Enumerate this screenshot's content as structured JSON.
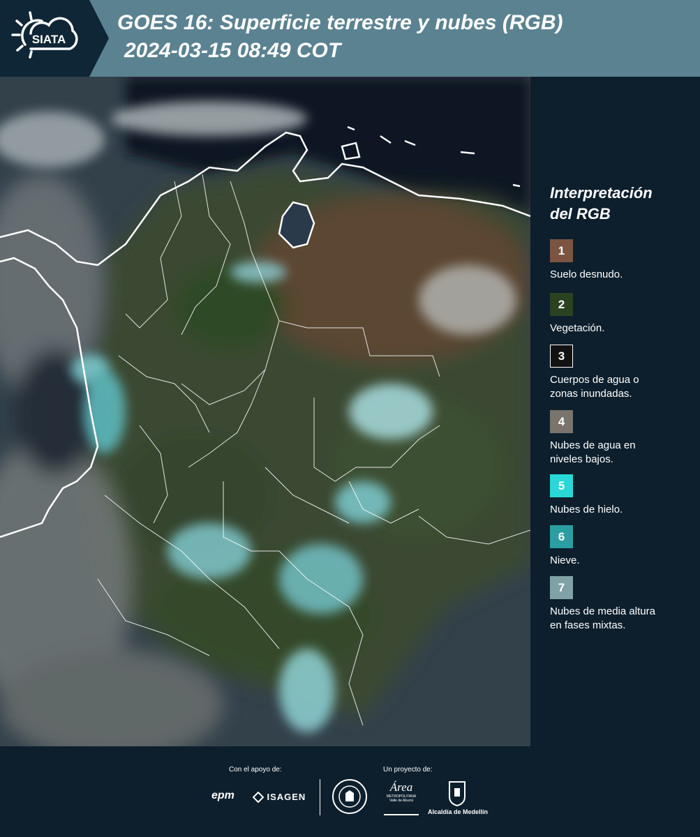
{
  "header": {
    "logo_text": "SIATA",
    "title_line1": "GOES 16: Superficie terrestre y nubes (RGB)",
    "title_line2": "2024-03-15 08:49 COT"
  },
  "legend": {
    "title_line1": "Interpretación",
    "title_line2": "del RGB",
    "items": [
      {
        "number": "1",
        "color": "#7b5442",
        "line1": "Suelo desnudo.",
        "line2": ""
      },
      {
        "number": "2",
        "color": "#2b4221",
        "line1": "Vegetación.",
        "line2": ""
      },
      {
        "number": "3",
        "color": "#111111",
        "line1": "Cuerpos de agua o",
        "line2": "zonas inundadas."
      },
      {
        "number": "4",
        "color": "#79746c",
        "line1": "Nubes de agua en",
        "line2": "niveles bajos."
      },
      {
        "number": "5",
        "color": "#2ad7d7",
        "line1": "Nubes de hielo.",
        "line2": ""
      },
      {
        "number": "6",
        "color": "#2b9ea3",
        "line1": "Nieve.",
        "line2": ""
      },
      {
        "number": "7",
        "color": "#7fa2a6",
        "line1": "Nubes de media altura",
        "line2": "en fases mixtas."
      }
    ]
  },
  "footer": {
    "support_label": "Con el apoyo de:",
    "project_label": "Un proyecto de:",
    "sponsor_epm": "epm",
    "sponsor_isagen": "ISAGEN",
    "area_logo_text": "Área",
    "area_logo_sub": "METROPOLITANA",
    "area_logo_sub2": "Valle de Aburrá",
    "alcaldia_label": "Alcaldía de Medellín"
  }
}
